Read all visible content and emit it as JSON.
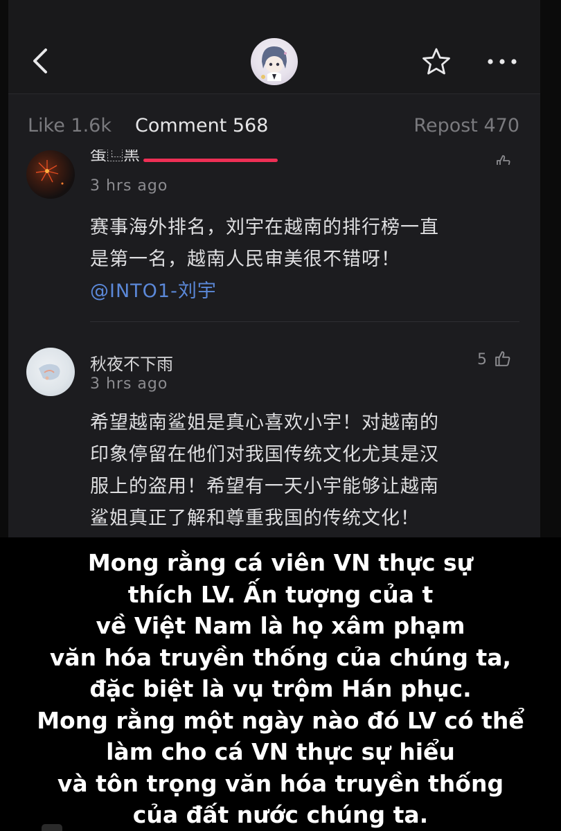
{
  "header": {
    "back_icon": "chevron-left-icon",
    "favorite_icon": "star-outline-icon",
    "more_icon": "more-horizontal-icon"
  },
  "tabs": [
    {
      "label": "Like 1.6k",
      "active": false
    },
    {
      "label": "Comment 568",
      "active": true
    },
    {
      "label": "Repost 470",
      "active": false
    }
  ],
  "comments": [
    {
      "name": "蛋⿺黑",
      "time": "3 hrs ago",
      "likes": "",
      "text_line1": "赛事海外排名，刘宇在越南的排行榜一直",
      "text_line2": "是第一名，越南人民审美很不错呀！",
      "mention": "@INTO1-刘宇"
    },
    {
      "name": "秋夜不下雨",
      "time": "3 hrs ago",
      "likes": "5",
      "text_lines": [
        "希望越南鲨姐是真心喜欢小宇！对越南的",
        "印象停留在他们对我国传统文化尤其是汉",
        "服上的盗用！希望有一天小宇能够让越南",
        "鲨姐真正了解和尊重我国的传统文化！"
      ]
    }
  ],
  "caption": {
    "lines": [
      "Mong rằng cá viên VN thực sự",
      "thích LV. Ấn tượng của t",
      "về Việt Nam là họ xâm phạm",
      "văn hóa truyền thống của chúng ta,",
      "đặc biệt là vụ trộm Hán phục.",
      "Mong rằng một ngày nào đó LV có thể",
      "làm cho cá VN thực sự hiểu",
      "và tôn trọng văn hóa truyền thống",
      "của đất nước chúng ta."
    ]
  },
  "colors": {
    "background": "#1c1c1f",
    "accent": "#ee2f55",
    "mention": "#5b88d8",
    "caption_bg": "#000000"
  }
}
